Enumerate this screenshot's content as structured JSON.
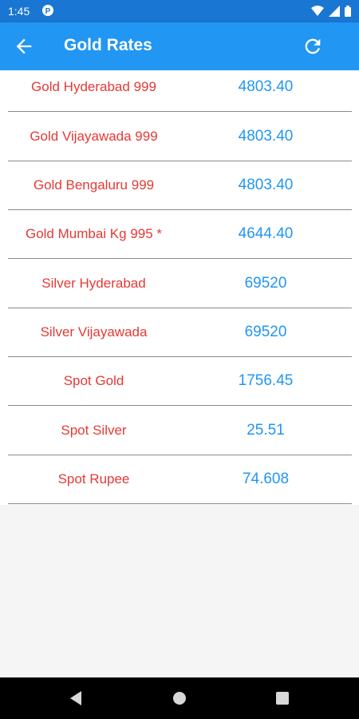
{
  "status_bar": {
    "time": "1:45"
  },
  "app_bar": {
    "title": "Gold Rates"
  },
  "rates": [
    {
      "name": "Gold Hyderabad 999",
      "value": "4803.40"
    },
    {
      "name": "Gold Vijayawada 999",
      "value": "4803.40"
    },
    {
      "name": "Gold Bengaluru 999",
      "value": "4803.40"
    },
    {
      "name": "Gold Mumbai Kg 995 *",
      "value": "4644.40"
    },
    {
      "name": "Silver Hyderabad",
      "value": "69520"
    },
    {
      "name": "Silver Vijayawada",
      "value": "69520"
    },
    {
      "name": "Spot Gold",
      "value": "1756.45"
    },
    {
      "name": "Spot Silver",
      "value": "25.51"
    },
    {
      "name": "Spot Rupee",
      "value": "74.608"
    }
  ],
  "colors": {
    "app_bar": "#2196f3",
    "status_bar": "#1976d2",
    "name_text": "#e53935",
    "value_text": "#2196f3"
  },
  "icons": {
    "back": "arrow-left-icon",
    "refresh": "refresh-icon",
    "nav_back": "triangle-back-icon",
    "nav_home": "circle-home-icon",
    "nav_recents": "square-recents-icon"
  }
}
